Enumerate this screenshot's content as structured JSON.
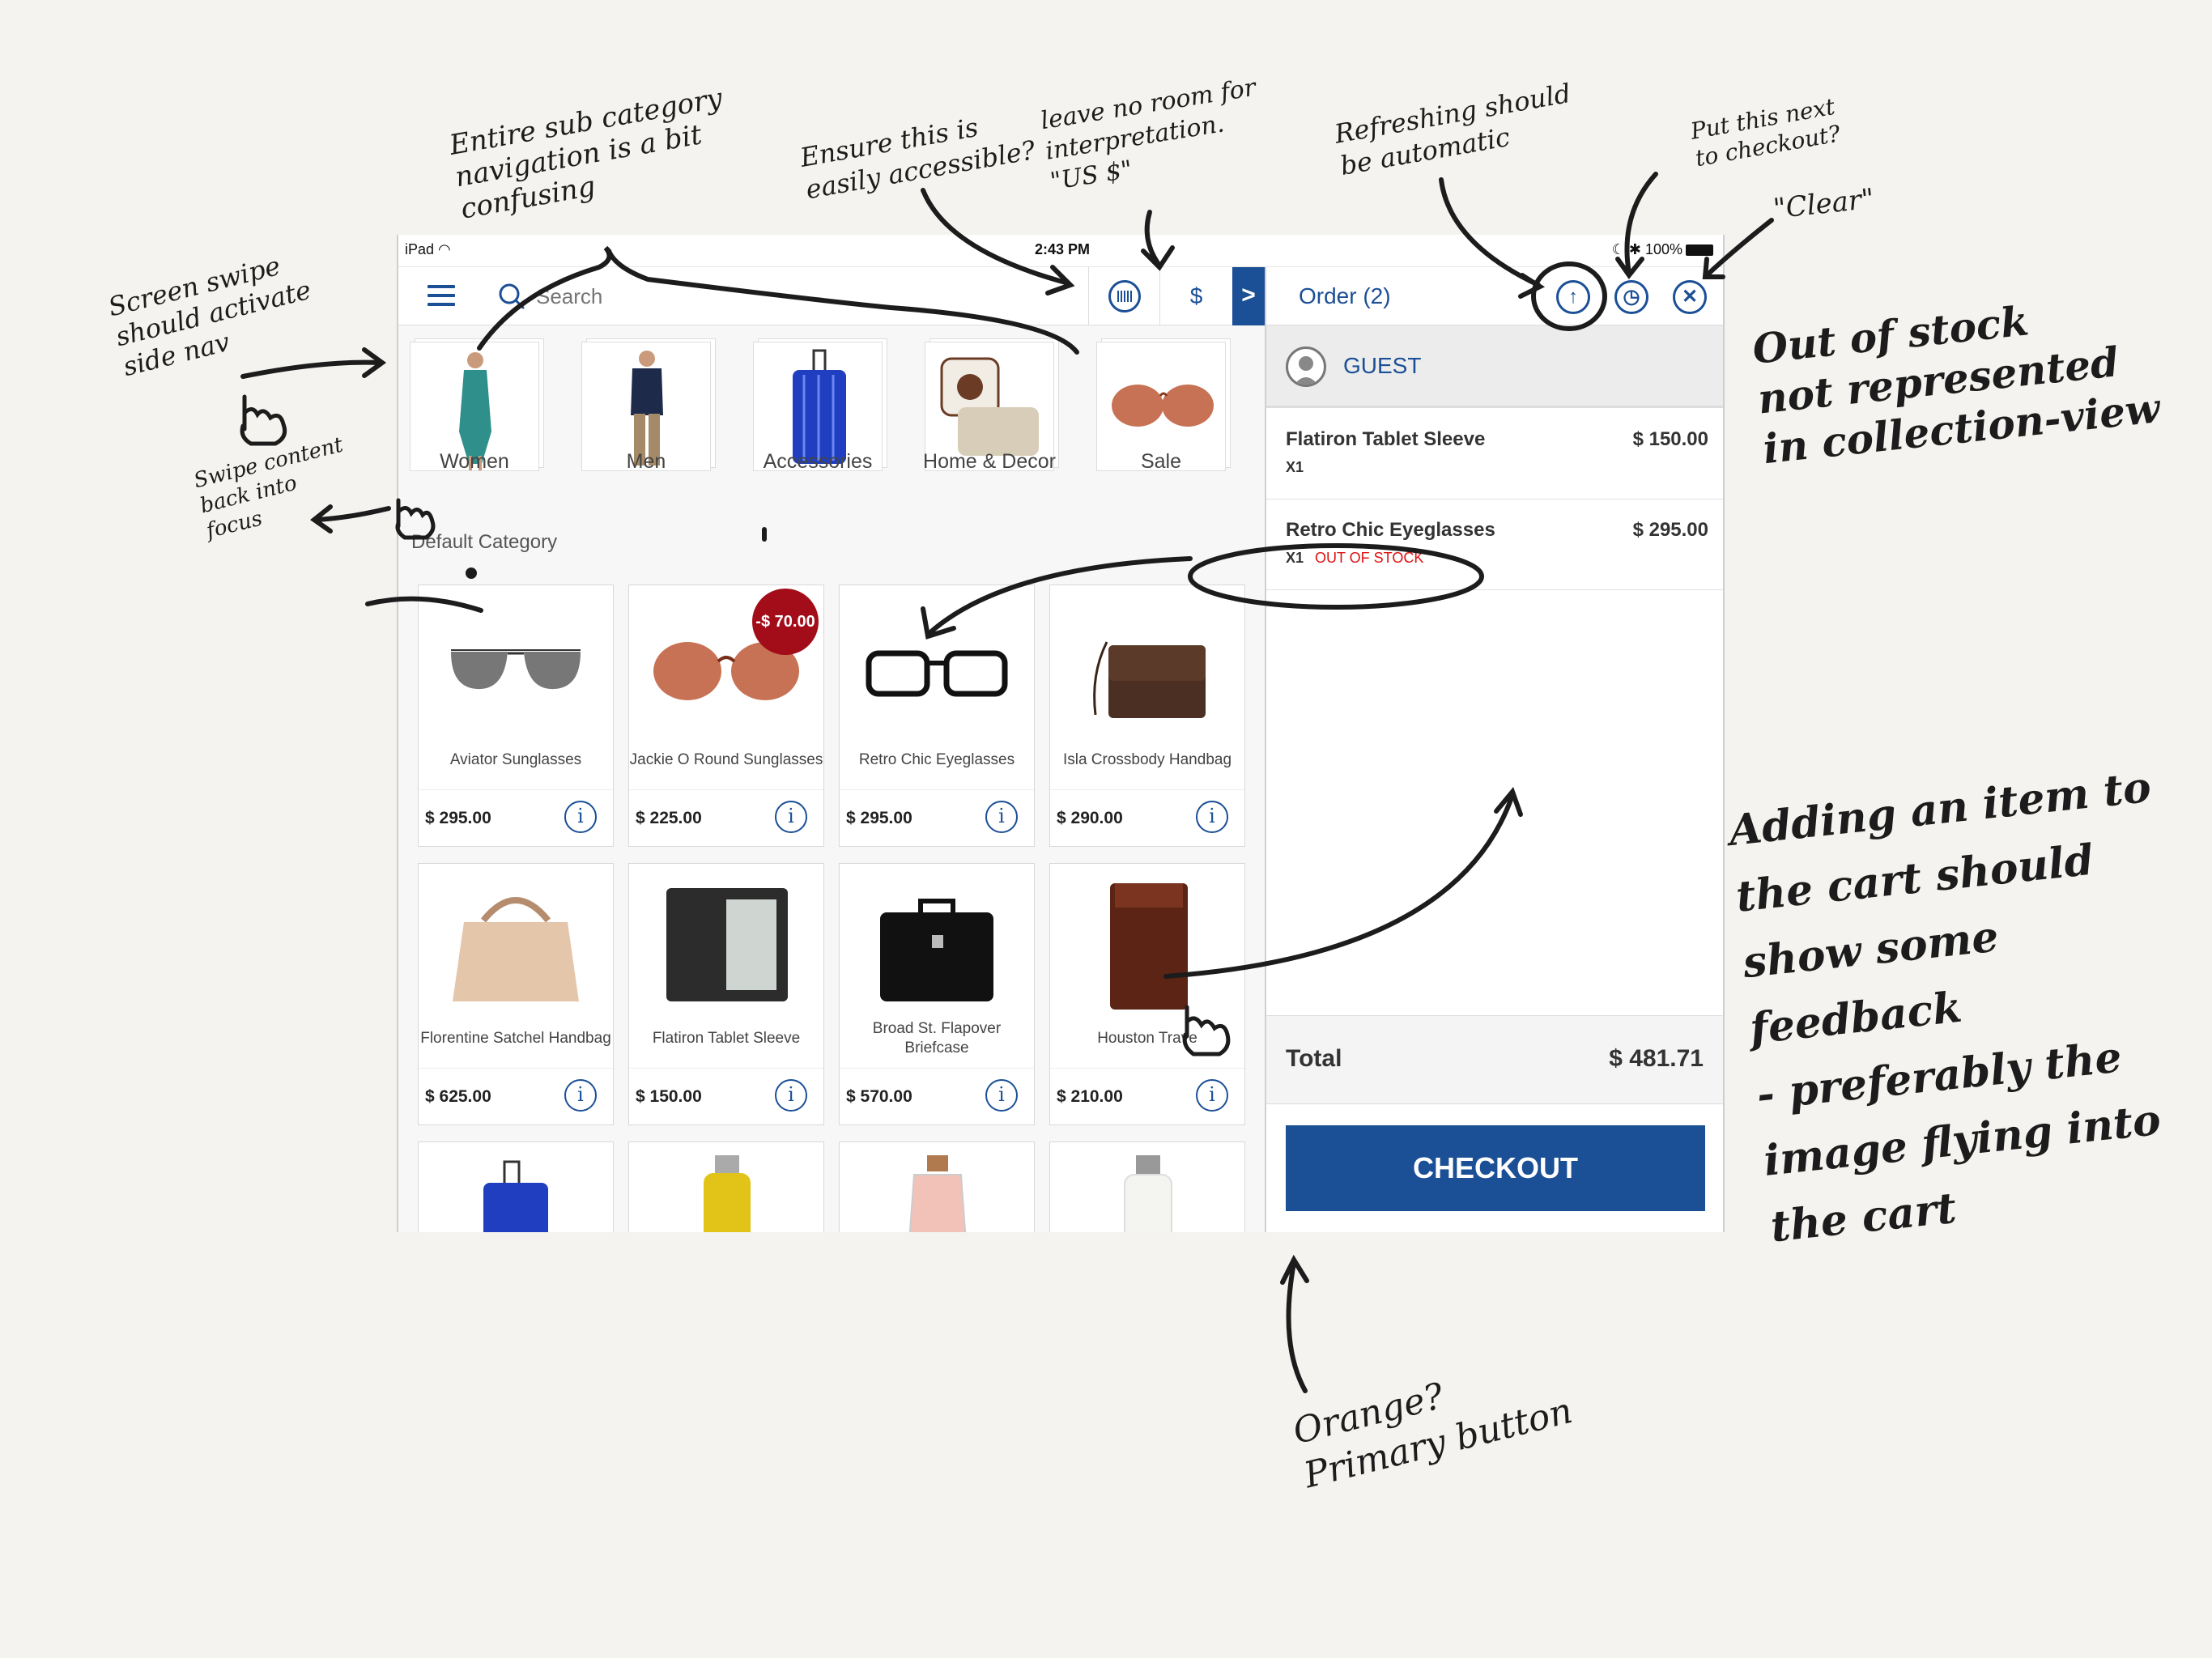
{
  "status_bar": {
    "device": "iPad",
    "time": "2:43 PM",
    "battery": "100%"
  },
  "toolbar": {
    "menu_icon": "hamburger-icon",
    "search_icon": "search-icon",
    "search_placeholder": "Search",
    "barcode_icon": "barcode-icon",
    "currency_label": "$",
    "collapse_label": ">"
  },
  "categories": [
    {
      "label": "Women"
    },
    {
      "label": "Men"
    },
    {
      "label": "Accessories"
    },
    {
      "label": "Home & Decor"
    },
    {
      "label": "Sale"
    }
  ],
  "breadcrumb": "Default Category",
  "products": [
    {
      "name": "Aviator Sunglasses",
      "price": "$ 295.00"
    },
    {
      "name": "Jackie O Round Sunglasses",
      "price": "$ 225.00",
      "badge": "-$ 70.00"
    },
    {
      "name": "Retro Chic Eyeglasses",
      "price": "$ 295.00"
    },
    {
      "name": "Isla Crossbody Handbag",
      "price": "$ 290.00"
    },
    {
      "name": "Florentine Satchel Handbag",
      "price": "$ 625.00"
    },
    {
      "name": "Flatiron Tablet Sleeve",
      "price": "$ 150.00"
    },
    {
      "name": "Broad St. Flapover Briefcase",
      "price": "$ 570.00"
    },
    {
      "name": "Houston Trave",
      "price": "$ 210.00"
    }
  ],
  "order": {
    "title": "Order (2)",
    "customer": "GUEST",
    "items": [
      {
        "name": "Flatiron Tablet Sleeve",
        "qty": "X1",
        "price": "$ 150.00",
        "status": ""
      },
      {
        "name": "Retro Chic Eyeglasses",
        "qty": "X1",
        "price": "$ 295.00",
        "status": "OUT OF STOCK"
      }
    ],
    "total_label": "Total",
    "total_value": "$ 481.71",
    "checkout_label": "CHECKOUT"
  },
  "annotations": {
    "sub_category": "Entire sub category\nnavigation is a bit\nconfusing",
    "accessible": "Ensure this is\neasily accessible?",
    "currency": "leave no room for\ninterpretation.\n\"US $\"",
    "refresh": "Refreshing should\nbe automatic",
    "history": "Put this next\nto checkout?",
    "clear": "\"Clear\"",
    "swipe_side": "Screen swipe\nshould activate\nside nav",
    "swipe_focus": "Swipe content\nback into\nfocus",
    "out_of_stock": "Out of stock\nnot represented\nin collection-view",
    "add_feedback": "Adding an item to\nthe cart should\nshow some feedback\n- preferably the\nimage flying into\nthe cart",
    "primary_button": "Orange?\nPrimary button"
  },
  "colors": {
    "brand_blue": "#1b4f96",
    "sale_red": "#a30d1a",
    "out_of_stock_red": "#dd1111",
    "paper": "#f4f3ef"
  }
}
